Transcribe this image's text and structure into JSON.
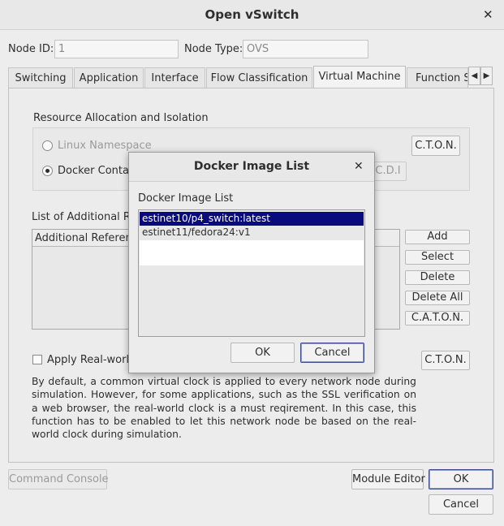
{
  "window": {
    "title": "Open vSwitch",
    "close_glyph": "✕"
  },
  "node": {
    "id_label": "Node ID:",
    "id_value": "1",
    "type_label": "Node Type:",
    "type_value": "OVS"
  },
  "tabs": [
    {
      "label": "Switching"
    },
    {
      "label": "Application"
    },
    {
      "label": "Interface"
    },
    {
      "label": "Flow Classification"
    },
    {
      "label": "Virtual Machine",
      "active": true
    },
    {
      "label": "Function Sw"
    }
  ],
  "tab_scroll": {
    "left": "◀",
    "right": "▶"
  },
  "resource": {
    "heading": "Resource Allocation and Isolation",
    "option1": "Linux Namespace",
    "option2": "Docker Contai",
    "caton_btn": "C.T.O.N.",
    "cdi_btn": "C.D.I"
  },
  "refs": {
    "heading": "List of Additional Re",
    "column_header": "Additional Reference",
    "buttons": {
      "add": "Add",
      "select": "Select",
      "delete": "Delete",
      "delete_all": "Delete All",
      "caton": "C.A.T.O.N."
    }
  },
  "realworld": {
    "checkbox_label": "Apply Real-world",
    "caton_btn": "C.T.O.N.",
    "description": "By default, a common virtual clock is applied to every network node during simulation. However, for some applications, such as the SSL verification on a web browser, the real-world clock is a must reqirement. In this case, this function has to be enabled to let this network node be based on the real-world clock during simulation."
  },
  "footer": {
    "command_console": "Command   Console",
    "module_editor": "Module Editor",
    "ok": "OK",
    "cancel": "Cancel"
  },
  "dialog": {
    "title": "Docker Image List",
    "close_glyph": "✕",
    "list_label": "Docker Image List",
    "items": [
      {
        "label": "estinet10/p4_switch:latest",
        "selected": true
      },
      {
        "label": "estinet11/fedora24:v1",
        "selected": false
      }
    ],
    "ok": "OK",
    "cancel": "Cancel"
  }
}
